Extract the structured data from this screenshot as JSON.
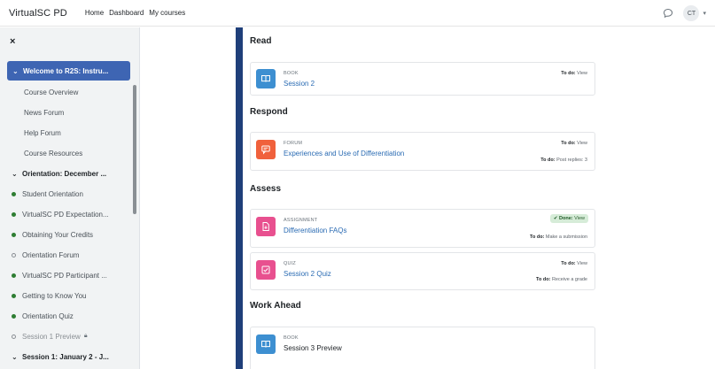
{
  "navbar": {
    "brand": "VirtualSC PD",
    "links": [
      "Home",
      "Dashboard",
      "My courses"
    ],
    "avatar_initials": "CT"
  },
  "drawer": {
    "close_glyph": "×",
    "active_item": "Welcome to R2S: Instru...",
    "welcome_subitems": [
      "Course Overview",
      "News Forum",
      "Help Forum",
      "Course Resources"
    ],
    "orientation_section": "Orientation: December ...",
    "orientation_items": [
      {
        "label": "Student Orientation",
        "status": "complete"
      },
      {
        "label": "VirtualSC PD Expectation...",
        "status": "complete"
      },
      {
        "label": "Obtaining Your Credits",
        "status": "complete"
      },
      {
        "label": "Orientation Forum",
        "status": "incomplete"
      },
      {
        "label": "VirtualSC PD Participant ...",
        "status": "complete"
      },
      {
        "label": "Getting to Know You",
        "status": "complete"
      },
      {
        "label": "Orientation Quiz",
        "status": "complete"
      },
      {
        "label": "Session 1 Preview",
        "status": "incomplete",
        "locked": true
      }
    ],
    "session1_section": "Session 1: January 2 - J..."
  },
  "sections": {
    "read": {
      "title": "Read",
      "card": {
        "type": "BOOK",
        "name": "Session 2",
        "todo_label": "To do:",
        "todo_value": "View",
        "icon": "book-icon",
        "color": "#3d8fd1"
      }
    },
    "respond": {
      "title": "Respond",
      "card": {
        "type": "FORUM",
        "name": "Experiences and Use of Differentiation",
        "todo1_label": "To do:",
        "todo1_value": "View",
        "todo2_label": "To do:",
        "todo2_value": "Post replies: 3",
        "icon": "forum-icon",
        "color": "#f0613c"
      }
    },
    "assess": {
      "title": "Assess",
      "assignment": {
        "type": "ASSIGNMENT",
        "name": "Differentiation FAQs",
        "done_label": "Done:",
        "done_value": "View",
        "todo_label": "To do:",
        "todo_value": "Make a submission",
        "icon": "assignment-icon",
        "color": "#e8508f"
      },
      "quiz": {
        "type": "QUIZ",
        "name": "Session 2 Quiz",
        "todo1_label": "To do:",
        "todo1_value": "View",
        "todo2_label": "To do:",
        "todo2_value": "Receive a grade",
        "icon": "quiz-icon",
        "color": "#e8508f"
      }
    },
    "work_ahead": {
      "title": "Work Ahead",
      "card": {
        "type": "BOOK",
        "name": "Session 3 Preview",
        "icon": "book-icon",
        "color": "#3d8fd1"
      }
    }
  }
}
